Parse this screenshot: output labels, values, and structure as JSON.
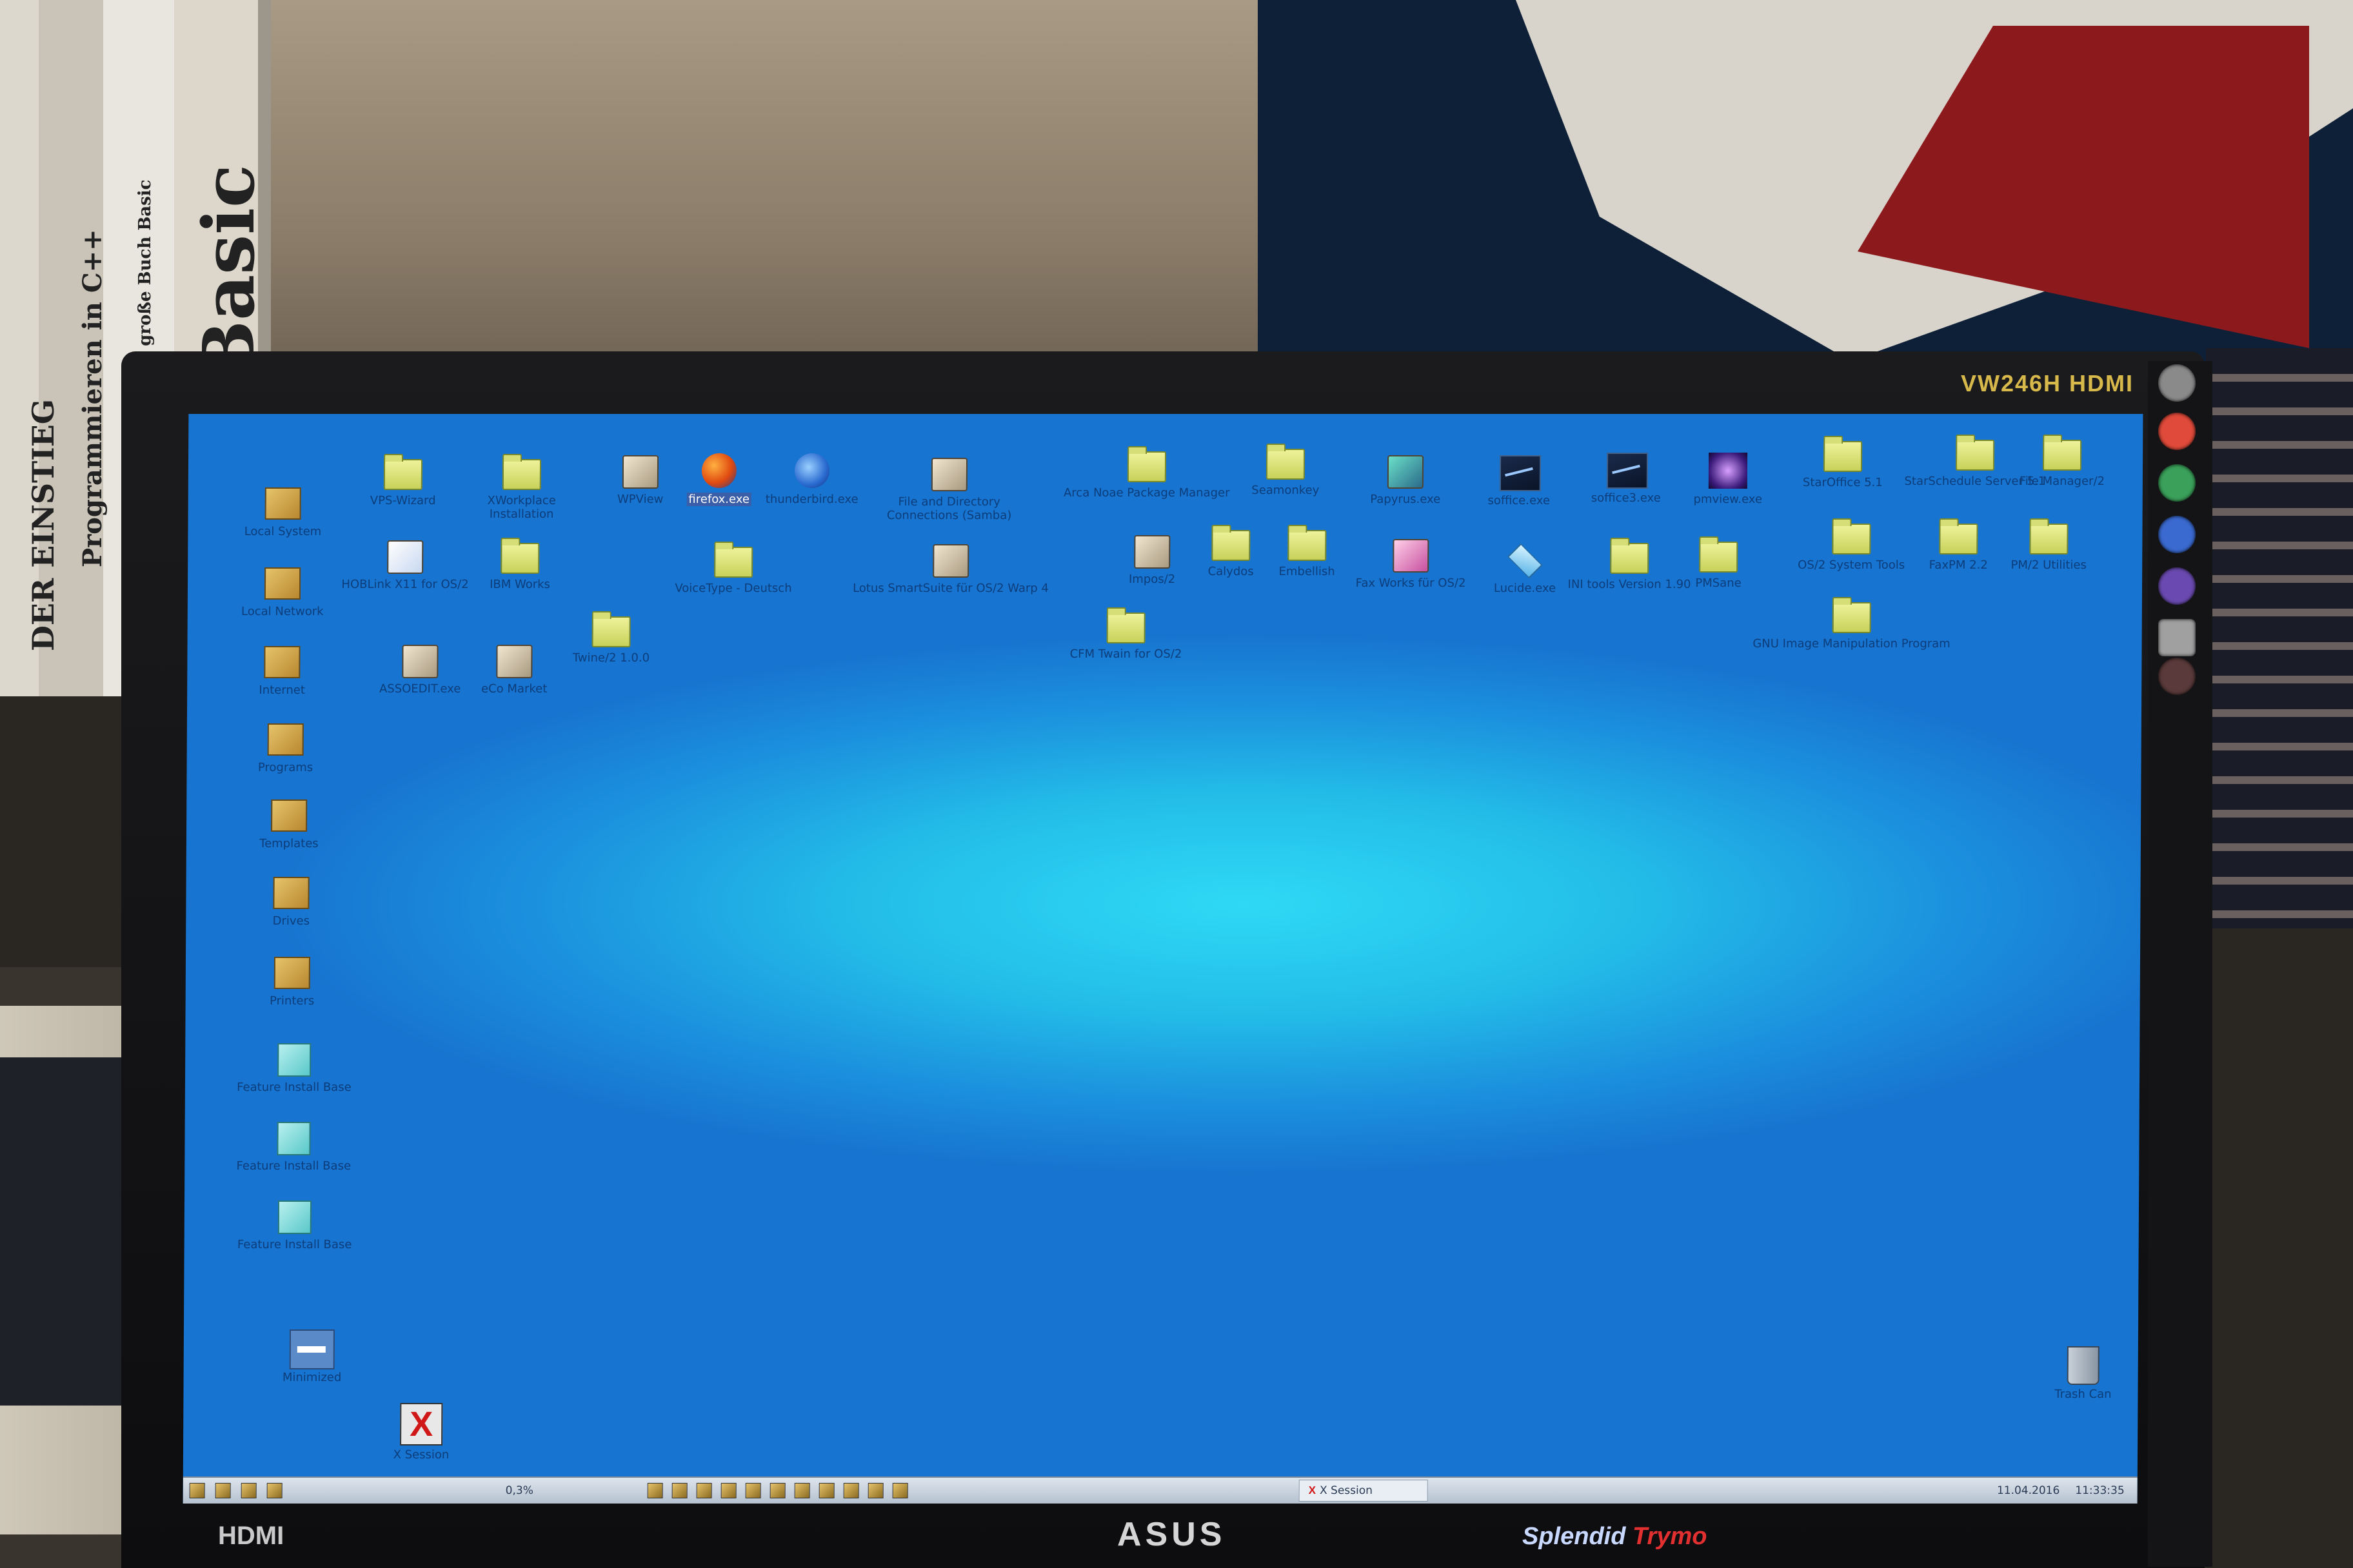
{
  "books": {
    "spine_1": "DER EINSTIEG",
    "spine_2": "Programmieren in C++",
    "spine_3": "Das große Buch Basic",
    "spine_top": "Basic"
  },
  "monitor": {
    "model": "VW246H HDMI",
    "hdmi": "HDMI",
    "brand": "ASUS",
    "splendid": "Splendid",
    "trymo": "Trymo"
  },
  "desktop": {
    "icons": [
      {
        "label": "Local System",
        "icon": "local-system-icon"
      },
      {
        "label": "Local Network",
        "icon": "network-icon"
      },
      {
        "label": "Internet",
        "icon": "internet-icon"
      },
      {
        "label": "Programs",
        "icon": "programs-icon"
      },
      {
        "label": "Templates",
        "icon": "templates-icon"
      },
      {
        "label": "Drives",
        "icon": "drives-icon"
      },
      {
        "label": "Printers",
        "icon": "printers-icon"
      },
      {
        "label": "Feature Install Base",
        "icon": "cube-icon"
      },
      {
        "label": "Feature Install Base",
        "icon": "cube-icon"
      },
      {
        "label": "Feature Install Base",
        "icon": "cube-icon"
      },
      {
        "label": "Minimized",
        "icon": "minimized-window-icon"
      },
      {
        "label": "X Session",
        "icon": "x-session-icon"
      },
      {
        "label": "VPS-Wizard",
        "icon": "folder-icon"
      },
      {
        "label": "XWorkplace Installation",
        "icon": "folder-icon"
      },
      {
        "label": "WPView",
        "icon": "wpview-icon"
      },
      {
        "label": "firefox.exe",
        "icon": "firefox-icon"
      },
      {
        "label": "thunderbird.exe",
        "icon": "thunderbird-icon"
      },
      {
        "label": "File and Directory Connections (Samba)",
        "icon": "samba-icon"
      },
      {
        "label": "Arca Noae Package Manager",
        "icon": "folder-icon"
      },
      {
        "label": "Seamonkey",
        "icon": "folder-icon"
      },
      {
        "label": "Papyrus.exe",
        "icon": "papyrus-icon"
      },
      {
        "label": "soffice.exe",
        "icon": "soffice-icon"
      },
      {
        "label": "soffice3.exe",
        "icon": "soffice-icon"
      },
      {
        "label": "pmview.exe",
        "icon": "pmview-icon"
      },
      {
        "label": "StarOffice 5.1",
        "icon": "folder-icon"
      },
      {
        "label": "StarSchedule Server 5.1",
        "icon": "folder-icon"
      },
      {
        "label": "File Manager/2",
        "icon": "folder-icon"
      },
      {
        "label": "HOBLink X11 for OS/2",
        "icon": "hoblink-icon"
      },
      {
        "label": "IBM Works",
        "icon": "folder-icon"
      },
      {
        "label": "VoiceType - Deutsch",
        "icon": "folder-icon"
      },
      {
        "label": "Lotus SmartSuite für OS/2 Warp 4",
        "icon": "lotus-icon"
      },
      {
        "label": "Impos/2",
        "icon": "impos-icon"
      },
      {
        "label": "Calydos",
        "icon": "folder-icon"
      },
      {
        "label": "Embellish",
        "icon": "folder-icon"
      },
      {
        "label": "Fax Works für OS/2",
        "icon": "faxworks-icon"
      },
      {
        "label": "Lucide.exe",
        "icon": "lucide-icon"
      },
      {
        "label": "INI tools Version 1.90",
        "icon": "folder-icon"
      },
      {
        "label": "PMSane",
        "icon": "folder-icon"
      },
      {
        "label": "OS/2 System Tools",
        "icon": "folder-icon"
      },
      {
        "label": "FaxPM 2.2",
        "icon": "folder-icon"
      },
      {
        "label": "PM/2 Utilities",
        "icon": "folder-icon"
      },
      {
        "label": "ASSOEDIT.exe",
        "icon": "assoedit-icon"
      },
      {
        "label": "eCo Market",
        "icon": "ecomarket-icon"
      },
      {
        "label": "Twine/2 1.0.0",
        "icon": "folder-icon"
      },
      {
        "label": "CFM Twain for OS/2",
        "icon": "folder-icon"
      },
      {
        "label": "GNU Image Manipulation Program",
        "icon": "folder-icon"
      },
      {
        "label": "Trash Can",
        "icon": "trash-icon"
      }
    ]
  },
  "taskbar": {
    "cpu": "0,3%",
    "task": "X Session",
    "date": "11.04.2016",
    "time": "11:33:35"
  }
}
